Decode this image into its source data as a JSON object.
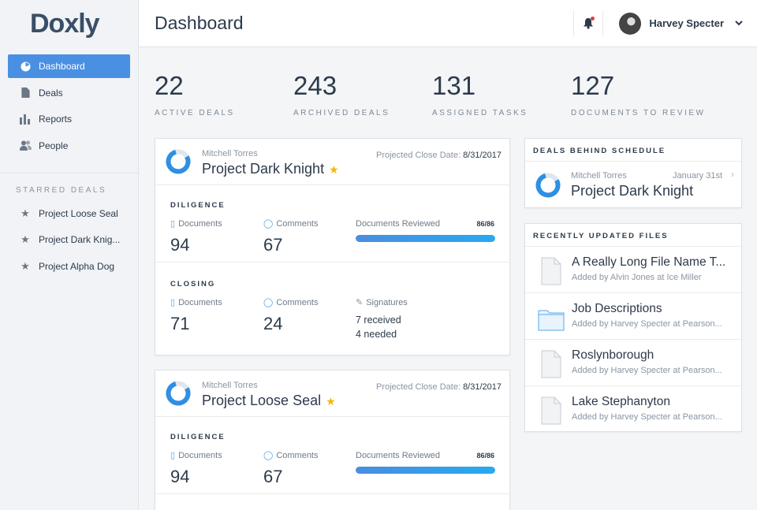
{
  "app": {
    "logo": "Doxly"
  },
  "header": {
    "title": "Dashboard",
    "user_name": "Harvey Specter"
  },
  "sidebar": {
    "items": [
      {
        "label": "Dashboard",
        "icon": "dashboard-icon"
      },
      {
        "label": "Deals",
        "icon": "document-icon"
      },
      {
        "label": "Reports",
        "icon": "bar-chart-icon"
      },
      {
        "label": "People",
        "icon": "people-icon"
      }
    ],
    "starred_heading": "STARRED DEALS",
    "starred": [
      {
        "label": "Project Loose Seal"
      },
      {
        "label": "Project Dark Knig..."
      },
      {
        "label": "Project Alpha Dog"
      }
    ]
  },
  "stats": [
    {
      "value": "22",
      "label": "ACTIVE DEALS"
    },
    {
      "value": "243",
      "label": "ARCHIVED DEALS"
    },
    {
      "value": "131",
      "label": "ASSIGNED TASKS"
    },
    {
      "value": "127",
      "label": "DOCUMENTS TO REVIEW"
    }
  ],
  "deals": [
    {
      "owner": "Mitchell Torres",
      "name": "Project Dark Knight",
      "close_label": "Projected Close Date:",
      "close_date": "8/31/2017",
      "diligence": {
        "title": "DILIGENCE",
        "documents_label": "Documents",
        "documents": "94",
        "comments_label": "Comments",
        "comments": "67",
        "reviewed_label": "Documents Reviewed",
        "reviewed_count": "86/86",
        "reviewed_fraction": 1.0
      },
      "closing": {
        "title": "CLOSING",
        "documents_label": "Documents",
        "documents": "71",
        "comments_label": "Comments",
        "comments": "24",
        "signatures_label": "Signatures",
        "received": "7 received",
        "needed": "4 needed"
      }
    },
    {
      "owner": "Mitchell Torres",
      "name": "Project Loose Seal",
      "close_label": "Projected Close Date:",
      "close_date": "8/31/2017",
      "diligence": {
        "title": "DILIGENCE",
        "documents_label": "Documents",
        "documents": "94",
        "comments_label": "Comments",
        "comments": "67",
        "reviewed_label": "Documents Reviewed",
        "reviewed_count": "86/86",
        "reviewed_fraction": 1.0
      }
    }
  ],
  "behind": {
    "title": "DEALS BEHIND SCHEDULE",
    "owner": "Mitchell Torres",
    "date": "January 31st",
    "name": "Project Dark Knight"
  },
  "files": {
    "title": "RECENTLY UPDATED FILES",
    "items": [
      {
        "name": "A Really Long File Name T...",
        "sub": "Added by Alvin Jones at Ice Miller",
        "icon": "file-icon"
      },
      {
        "name": "Job Descriptions",
        "sub": "Added by Harvey Specter at Pearson...",
        "icon": "folder-icon"
      },
      {
        "name": "Roslynborough",
        "sub": "Added by Harvey Specter at Pearson...",
        "icon": "file-icon"
      },
      {
        "name": "Lake Stephanyton",
        "sub": "Added by Harvey Specter at Pearson...",
        "icon": "file-icon"
      }
    ]
  },
  "colors": {
    "accent": "#4a90e2",
    "star": "#f5b60b",
    "progress": "#27aaf0"
  }
}
